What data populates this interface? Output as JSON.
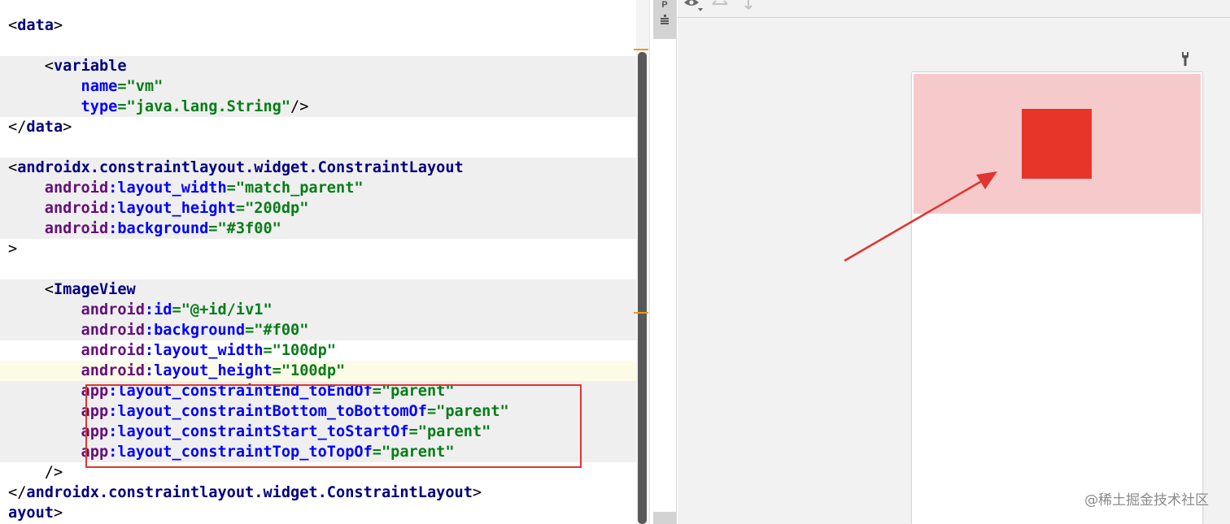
{
  "editor": {
    "lines": [
      [
        [
          "p",
          "<"
        ],
        [
          "t",
          "data"
        ],
        [
          "p",
          ">"
        ]
      ],
      [],
      [
        [
          "p",
          "    <"
        ],
        [
          "t",
          "variable"
        ]
      ],
      [
        [
          "a",
          "        name"
        ],
        [
          "v",
          "=\"vm\""
        ]
      ],
      [
        [
          "a",
          "        type"
        ],
        [
          "v",
          "=\"java.lang.String\""
        ],
        [
          "p",
          "/>"
        ]
      ],
      [
        [
          "p",
          "</"
        ],
        [
          "t",
          "data"
        ],
        [
          "p",
          ">"
        ]
      ],
      [],
      [
        [
          "p",
          "<"
        ],
        [
          "t",
          "androidx.constraintlayout.widget.ConstraintLayout"
        ]
      ],
      [
        [
          "ns",
          "    android"
        ],
        [
          "a",
          ":layout_width"
        ],
        [
          "v",
          "=\"match_parent\""
        ]
      ],
      [
        [
          "ns",
          "    android"
        ],
        [
          "a",
          ":layout_height"
        ],
        [
          "v",
          "=\"200dp\""
        ]
      ],
      [
        [
          "ns",
          "    android"
        ],
        [
          "a",
          ":background"
        ],
        [
          "v",
          "=\"#3f00\""
        ]
      ],
      [
        [
          "p",
          ">"
        ]
      ],
      [],
      [
        [
          "p",
          "    <"
        ],
        [
          "t",
          "ImageView"
        ]
      ],
      [
        [
          "ns",
          "        android"
        ],
        [
          "a",
          ":id"
        ],
        [
          "v",
          "=\"@+id/iv1\""
        ]
      ],
      [
        [
          "ns",
          "        android"
        ],
        [
          "a",
          ":background"
        ],
        [
          "v",
          "=\"#f00\""
        ]
      ],
      [
        [
          "ns",
          "        android"
        ],
        [
          "a",
          ":layout_width"
        ],
        [
          "v",
          "=\"100dp\""
        ]
      ],
      [
        [
          "ns",
          "        android"
        ],
        [
          "a",
          ":layout_height"
        ],
        [
          "v",
          "=\"100dp\""
        ]
      ],
      [
        [
          "ns",
          "        app"
        ],
        [
          "a",
          ":layout_constraintEnd_toEndOf"
        ],
        [
          "v",
          "=\"parent\""
        ]
      ],
      [
        [
          "ns",
          "        app"
        ],
        [
          "a",
          ":layout_constraintBottom_toBottomOf"
        ],
        [
          "v",
          "=\"parent\""
        ]
      ],
      [
        [
          "ns",
          "        app"
        ],
        [
          "a",
          ":layout_constraintStart_toStartOf"
        ],
        [
          "v",
          "=\"parent\""
        ]
      ],
      [
        [
          "ns",
          "        app"
        ],
        [
          "a",
          ":layout_constraintTop_toTopOf"
        ],
        [
          "v",
          "=\"parent\""
        ]
      ],
      [
        [
          "p",
          "    />"
        ]
      ],
      [
        [
          "p",
          "</"
        ],
        [
          "t",
          "androidx.constraintlayout.widget.ConstraintLayout"
        ],
        [
          "p",
          ">"
        ]
      ],
      [
        [
          "t",
          "ayout"
        ],
        [
          "p",
          ">"
        ]
      ]
    ],
    "highlighted_lines": [
      2,
      3,
      4,
      7,
      8,
      9,
      10,
      13,
      14,
      15,
      18,
      19,
      20,
      21
    ],
    "caret_line": 17
  },
  "palette_strip": {
    "label": "P"
  },
  "design_panel": {
    "toolbar_icons": [
      "eye-icon",
      "horizontal-resize-icon",
      "vertical-resize-icon"
    ],
    "constraint_layout_color": "#f6cacb",
    "image_view_color": "#e8352a",
    "annotation_color": "#e03530"
  },
  "watermark": "@稀土掘金技术社区"
}
